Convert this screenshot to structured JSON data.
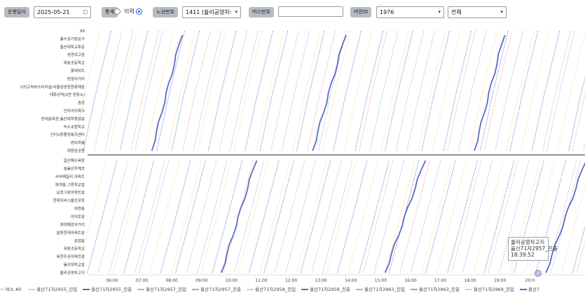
{
  "toolbar": {
    "date_label": "운행일자",
    "date_value": "2025-05-21",
    "mode_label": "통계",
    "mode_other_label": "이력",
    "selected_mode": "이력",
    "route_label": "노선번호",
    "route_value": "1411 (율리공영차:",
    "bus_label": "버스번호",
    "bus_value": "",
    "version_label": "버전ID",
    "version_value": "1976",
    "filter_value": "전체"
  },
  "chart_data": {
    "type": "line",
    "title": "",
    "xlabel": "",
    "ylabel": "",
    "x_ticks": [
      "06:00",
      "07:00",
      "08:00",
      "09:00",
      "10:00",
      "11:00",
      "12:00",
      "13:00",
      "14:00",
      "15:00",
      "16:00",
      "17:00",
      "18:00",
      "19:00",
      "20:0"
    ],
    "stops_upper": [
      "90",
      "울수공기장입구",
      "울산대학교후문",
      "성광여고앞",
      "옥동초등학교",
      "롯데마트",
      "번영사거리",
      "시외고속버스터미널/서울삼성창원화재앞",
      "태화강역(2번 정류소)",
      "효성",
      "인터아이파크",
      "한마음회관,울산대학병원앞",
      "녹수초등학교",
      "인터1동행정복지센터",
      "반딕마을",
      "대왕암공원"
    ],
    "stops_lower": [
      "일산해수욕장",
      "동울산우체국",
      "서부패밀리 아파트",
      "현대중,그릇학교앞",
      "남호그린아파트앞",
      "현대모비스울산공장",
      "여천동",
      "이이토앞",
      "현대해양사거리",
      "달동현대아파트앞",
      "공업탑",
      "옥동초등학교",
      "옥현주공아파트앞",
      "울산대학교앞",
      "율리공영차고지"
    ],
    "series": [
      {
        "name": "울산71자2955_진입",
        "color": "#ffcc80",
        "start": "06:10",
        "duration_min": 66
      },
      {
        "name": "울산71자2955_진출",
        "color": "#5c6bc0",
        "start": "06:16",
        "duration_min": 82
      },
      {
        "name": "울산71자2957_진입",
        "color": "#ef9a9a",
        "start": "06:30",
        "duration_min": 64
      },
      {
        "name": "울산71자2957_진출",
        "color": "#9fa8da",
        "start": "06:36",
        "duration_min": 78
      },
      {
        "name": "울산71자2958_진입",
        "color": "#ffcc80",
        "start": "06:50",
        "duration_min": 60
      },
      {
        "name": "울산71자2958_진출",
        "color": "#5c6bc0",
        "start": "06:56",
        "duration_min": 80
      },
      {
        "name": "울산71자2963_진입",
        "color": "#ef9a9a",
        "start": "07:10",
        "duration_min": 70
      },
      {
        "name": "울산71자2963_진출",
        "color": "#9fa8da",
        "start": "07:16",
        "duration_min": 76
      },
      {
        "name": "울산71자2969_진입",
        "color": "#ffcc80",
        "start": "07:30",
        "duration_min": 62
      },
      {
        "name": "울산71자2969_진출",
        "color": "#5c6bc0",
        "start": "07:36",
        "duration_min": 84
      }
    ],
    "highlight_series": "울산71자2957_진출",
    "highlight_runs": [
      {
        "start": "06:40",
        "end": "07:10",
        "direction": "up"
      },
      {
        "start": "07:50",
        "end": "08:25",
        "direction": "down"
      },
      {
        "start": "09:22",
        "end": "09:55",
        "direction": "up"
      },
      {
        "start": "10:35",
        "end": "11:15",
        "direction": "down"
      },
      {
        "start": "12:05",
        "end": "12:35",
        "direction": "up"
      },
      {
        "start": "13:17",
        "end": "13:57",
        "direction": "down"
      },
      {
        "start": "14:45",
        "end": "15:20",
        "direction": "up"
      },
      {
        "start": "16:05",
        "end": "16:45",
        "direction": "down"
      },
      {
        "start": "17:35",
        "end": "18:05",
        "direction": "up"
      },
      {
        "start": "19:20",
        "end": "19:59",
        "direction": "down"
      }
    ],
    "tooltip": {
      "stop": "율리공영차고지",
      "series": "울산71자2957_진출",
      "time": "18:39:52"
    }
  },
  "legend": {
    "prefix": "ㅡ 버스 All",
    "items": [
      "울산71자2955_진입",
      "울산71자2955_진출",
      "울산71자2957_진입",
      "울산71자2957_진출",
      "울산71자2958_진입",
      "울산71자2958_진출",
      "울산71자2963_진입",
      "울산71자2963_진출",
      "울산71자2969_진입",
      "울산7"
    ]
  }
}
